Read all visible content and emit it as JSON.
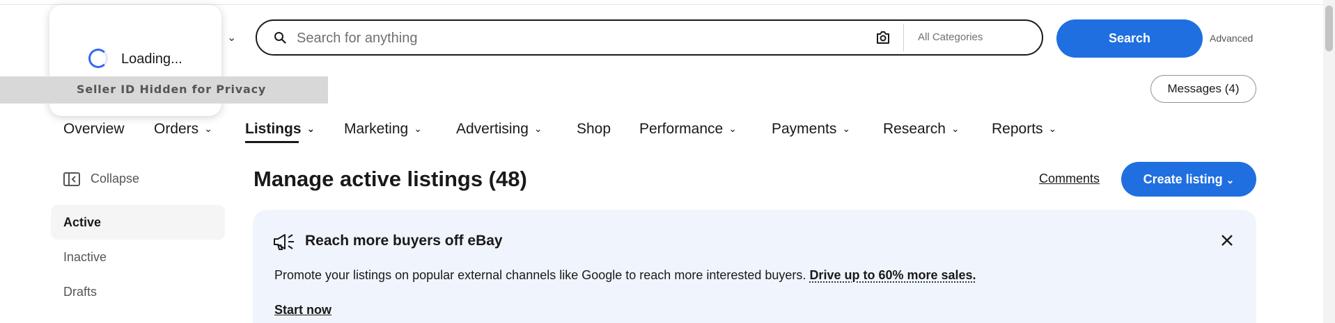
{
  "loading": {
    "text": "Loading..."
  },
  "seller": {
    "privacy_text": "Seller ID Hidden for Privacy"
  },
  "search": {
    "placeholder": "Search for anything",
    "categories": "All Categories",
    "button_label": "Search",
    "advanced_label": "Advanced"
  },
  "messages": {
    "label": "Messages (4)"
  },
  "nav": {
    "items": [
      {
        "label": "Overview"
      },
      {
        "label": "Orders"
      },
      {
        "label": "Listings",
        "active": true
      },
      {
        "label": "Marketing"
      },
      {
        "label": "Advertising"
      },
      {
        "label": "Shop"
      },
      {
        "label": "Performance"
      },
      {
        "label": "Payments"
      },
      {
        "label": "Research"
      },
      {
        "label": "Reports"
      }
    ]
  },
  "sidebar": {
    "collapse_label": "Collapse",
    "items": [
      {
        "label": "Active",
        "active": true
      },
      {
        "label": "Inactive"
      },
      {
        "label": "Drafts"
      }
    ]
  },
  "main": {
    "title": "Manage active listings (48)",
    "comments_label": "Comments",
    "create_label": "Create listing"
  },
  "banner": {
    "title": "Reach more buyers off eBay",
    "body": "Promote your listings on popular external channels like Google to reach more interested buyers.",
    "emphasis": "Drive up to 60% more sales.",
    "cta": "Start now"
  },
  "colors": {
    "accent": "#1f6fe0",
    "banner_bg": "#f0f5fd"
  }
}
